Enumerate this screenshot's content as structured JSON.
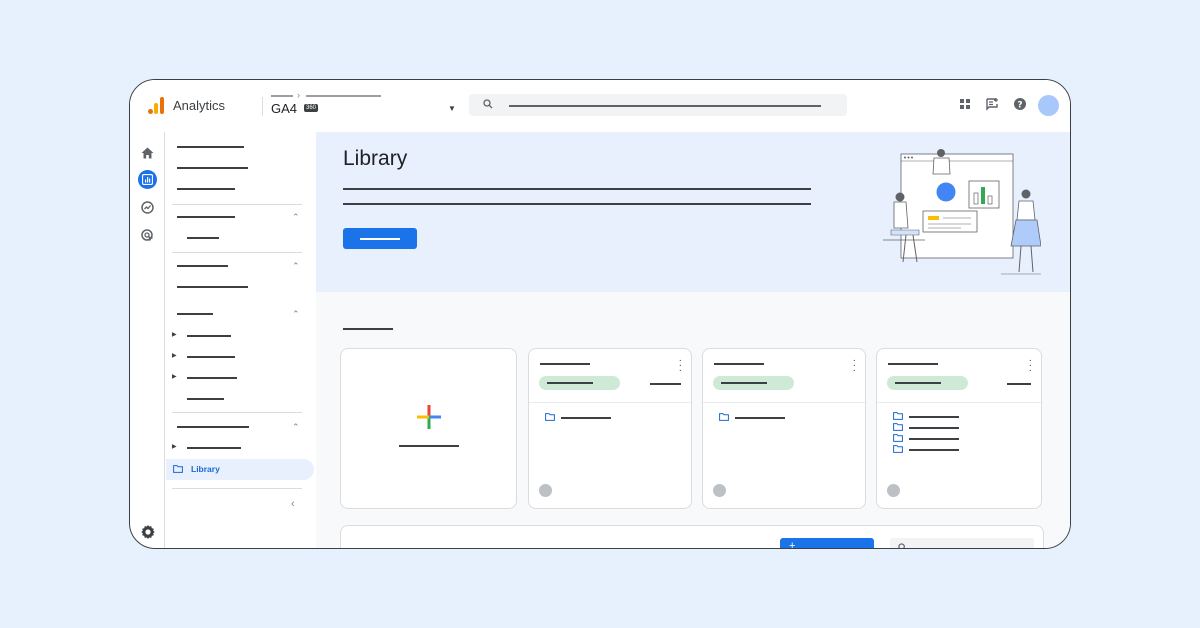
{
  "app": {
    "name": "Analytics",
    "property": "GA4",
    "property_badge": "360"
  },
  "toolbar_icons": [
    "apps-grid-icon",
    "feedback-icon",
    "help-icon",
    "avatar"
  ],
  "rail_icons": [
    "home-icon",
    "reports-icon",
    "explore-icon",
    "advertising-icon",
    "settings-icon"
  ],
  "nav": {
    "active_item": "Library"
  },
  "hero": {
    "title": "Library"
  },
  "colors": {
    "accent": "#1a73e8",
    "hero_bg": "#e8f0fe",
    "chip": "#ceead6",
    "page_bg": "#e7f1fd"
  }
}
